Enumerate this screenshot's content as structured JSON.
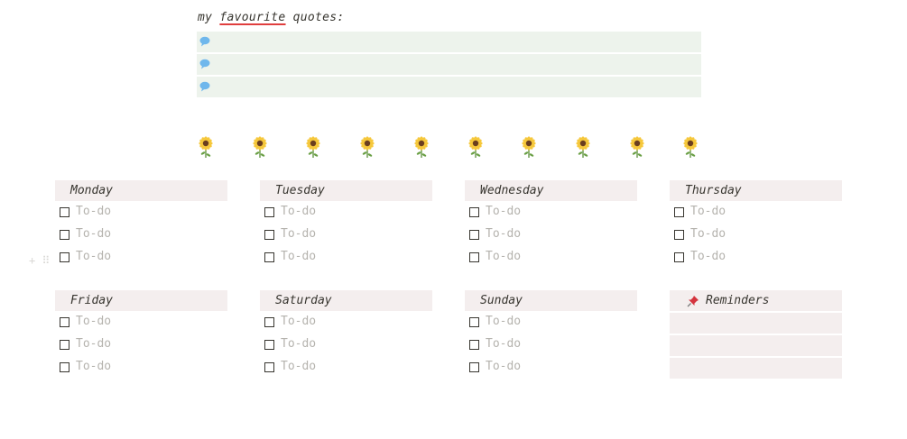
{
  "quotes": {
    "title_prefix": "my ",
    "title_emph": "favourite",
    "title_suffix": " quotes:",
    "rows": 3,
    "bubble_icon": "speech-bubble-icon",
    "bubble_color": "#6fb7ec",
    "row_color": "#edf3ec"
  },
  "decor": {
    "icon": "sunflower-icon",
    "count": 10
  },
  "todo_label": "To-do",
  "days": [
    {
      "name": "Monday"
    },
    {
      "name": "Tuesday"
    },
    {
      "name": "Wednesday"
    },
    {
      "name": "Thursday"
    },
    {
      "name": "Friday"
    },
    {
      "name": "Saturday"
    },
    {
      "name": "Sunday"
    }
  ],
  "reminders": {
    "title": "Reminders",
    "icon": "pushpin-icon",
    "rows": 3
  },
  "colors": {
    "header_bg": "#f4eeee",
    "placeholder": "#b5b3ae",
    "accent_underline": "#e03e3e"
  }
}
